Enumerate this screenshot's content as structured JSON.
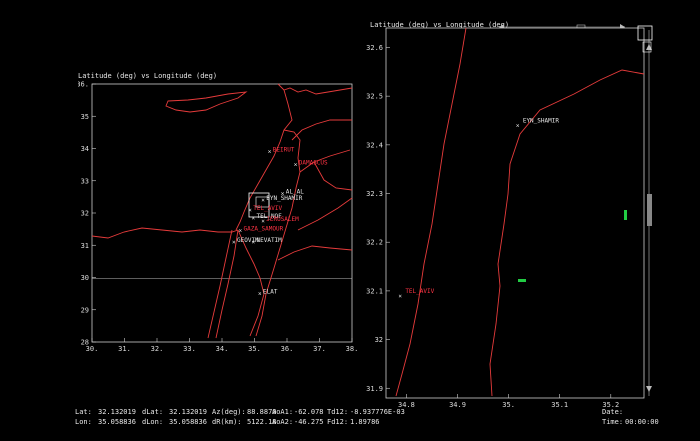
{
  "left_plot": {
    "title": "Latitude (deg) vs Longitude (deg)",
    "x_ticks": [
      "30.",
      "31.",
      "32.",
      "33.",
      "34.",
      "35.",
      "36.",
      "37.",
      "38."
    ],
    "y_ticks": [
      "36.",
      "35",
      "34",
      "33",
      "32",
      "31",
      "30",
      "29",
      "28"
    ],
    "labels": [
      {
        "text": "BEIRUT",
        "lon": 35.5,
        "lat": 33.9,
        "color": "#ff3344"
      },
      {
        "text": "DAMASCUS",
        "lon": 36.3,
        "lat": 33.5,
        "color": "#ff3344"
      },
      {
        "text": "AL_AL",
        "lon": 35.9,
        "lat": 32.6,
        "color": "#e6e6e6"
      },
      {
        "text": "EYN_SHAMIR",
        "lon": 35.3,
        "lat": 32.4,
        "color": "#e6e6e6"
      },
      {
        "text": "TEL_AVIV",
        "lon": 34.9,
        "lat": 32.1,
        "color": "#ff3344"
      },
      {
        "text": "TEL_NOF",
        "lon": 35.0,
        "lat": 31.85,
        "color": "#e6e6e6"
      },
      {
        "text": "JERUSALEM",
        "lon": 35.3,
        "lat": 31.75,
        "color": "#ff3344"
      },
      {
        "text": "GAZA_SAMOUR",
        "lon": 34.6,
        "lat": 31.45,
        "color": "#ff3344"
      },
      {
        "text": "GEOVIM",
        "lon": 34.4,
        "lat": 31.1,
        "color": "#e6e6e6"
      },
      {
        "text": "NEVATIM",
        "lon": 35.0,
        "lat": 31.1,
        "color": "#e6e6e6"
      },
      {
        "text": "ELAT",
        "lon": 35.2,
        "lat": 29.5,
        "color": "#e6e6e6"
      }
    ]
  },
  "right_plot": {
    "title": "Latitude (deg) vs Longitude (deg)",
    "x_ticks": [
      "34.8",
      "34.9",
      "35.",
      "35.1",
      "35.2"
    ],
    "y_ticks": [
      "32.6",
      "32.5",
      "32.4",
      "32.3",
      "32.2",
      "32.1",
      "32",
      "31.9"
    ],
    "labels": [
      {
        "text": "EYN_SHAMIR",
        "lon": 35.02,
        "lat": 32.44,
        "color": "#e6e6e6"
      },
      {
        "text": "TEL_AVIV",
        "lon": 34.79,
        "lat": 32.09,
        "color": "#ff3344"
      }
    ]
  },
  "status": {
    "lat_label": "Lat:",
    "lat_value": "32.132019",
    "dlat_label": "dLat:",
    "dlat_value": "32.132019",
    "az_label": "Az(deg):",
    "az_value": "88.8870",
    "aoa1_label": "AoA1:",
    "aoa1_value": "-62.078",
    "td12_label": "Td12:",
    "td12_value": "-8.937776E-03",
    "lon_label": "Lon:",
    "lon_value": "35.058836",
    "dlon_label": "dLon:",
    "dlon_value": "35.058836",
    "dr_label": "dR(km):",
    "dr_value": "5122.18",
    "aoa2_label": "AoA2:",
    "aoa2_value": "-46.275",
    "fd12_label": "Fd12:",
    "fd12_value": "1.89786",
    "date_label": "Date:",
    "date_value": "",
    "time_label": "Time:",
    "time_value": "00:00:00"
  },
  "colors": {
    "border": "#e63b3b",
    "label_red": "#ff3344",
    "green": "#22cc44"
  }
}
